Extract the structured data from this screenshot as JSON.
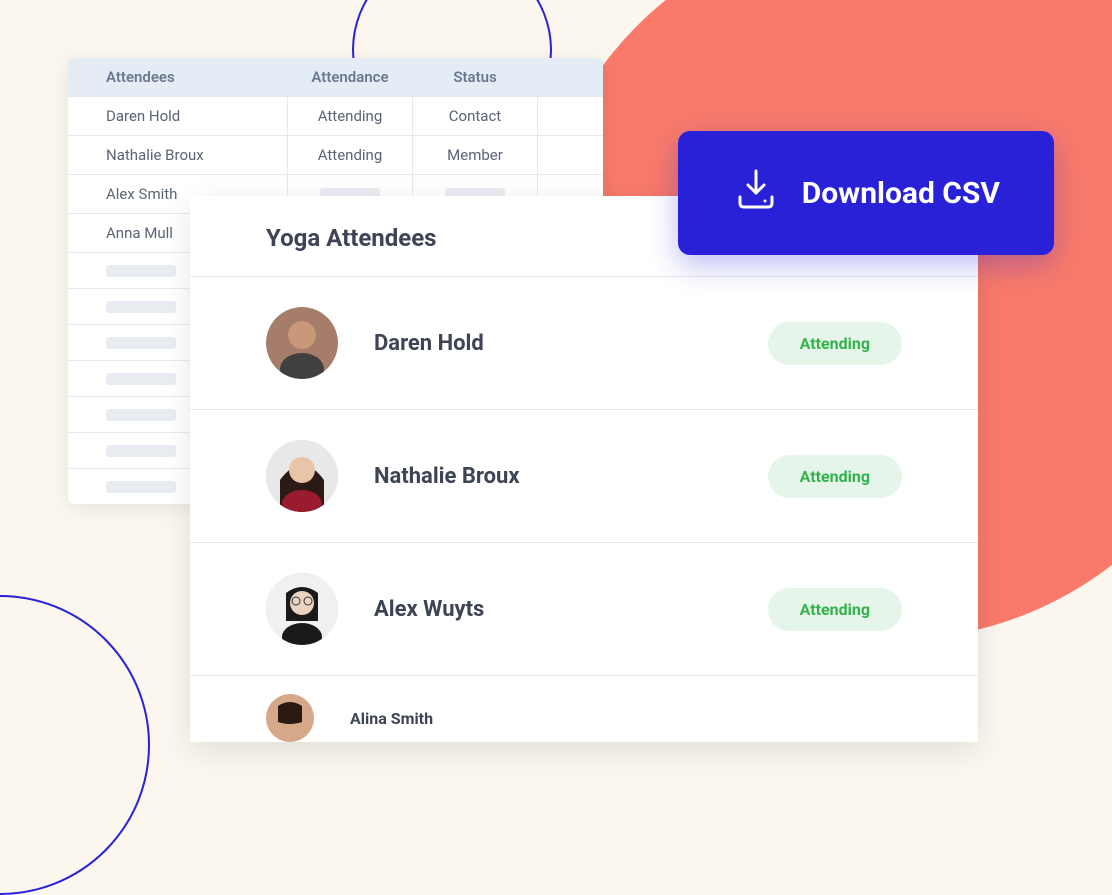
{
  "colors": {
    "accent": "#2821D8",
    "coral": "#F97A6A",
    "cream": "#FBF6EE",
    "success_bg": "#E6F5EA",
    "success_text": "#34B24C"
  },
  "download_button": {
    "label": "Download CSV"
  },
  "table": {
    "headers": {
      "attendees": "Attendees",
      "attendance": "Attendance",
      "status": "Status"
    },
    "rows": [
      {
        "name": "Daren Hold",
        "attendance": "Attending",
        "status": "Contact"
      },
      {
        "name": "Nathalie Broux",
        "attendance": "Attending",
        "status": "Member"
      },
      {
        "name": "Alex Smith",
        "attendance": "",
        "status": ""
      },
      {
        "name": "Anna Mull",
        "attendance": "",
        "status": ""
      }
    ]
  },
  "panel": {
    "title": "Yoga Attendees",
    "items": [
      {
        "name": "Daren Hold",
        "status": "Attending"
      },
      {
        "name": "Nathalie Broux",
        "status": "Attending"
      },
      {
        "name": "Alex Wuyts",
        "status": "Attending"
      },
      {
        "name": "Alina Smith",
        "status": ""
      }
    ]
  }
}
